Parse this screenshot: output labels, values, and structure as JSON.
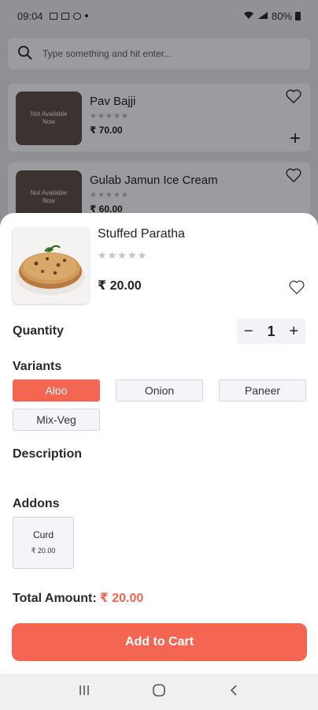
{
  "status_bar": {
    "time": "09:04",
    "battery": "80%"
  },
  "background_list": {
    "search_placeholder": "Type something and hit enter...",
    "items": [
      {
        "name": "Pav Bajji",
        "price": "₹ 70.00",
        "stars": "★★★★★",
        "badge": "Not Available Now"
      },
      {
        "name": "Gulab Jamun Ice Cream",
        "price": "₹ 60.00",
        "stars": "★★★★★",
        "badge": "Not Available Now"
      }
    ]
  },
  "product": {
    "name": "Stuffed Paratha",
    "stars": "★★★★★",
    "price": "₹ 20.00"
  },
  "quantity": {
    "label": "Quantity",
    "minus": "−",
    "value": "1",
    "plus": "+"
  },
  "variants": {
    "label": "Variants",
    "options": [
      "Aloo",
      "Onion",
      "Paneer",
      "Mix-Veg"
    ],
    "selected": "Aloo"
  },
  "description": {
    "label": "Description"
  },
  "addons": {
    "label": "Addons",
    "items": [
      {
        "name": "Curd",
        "price": "₹ 20.00"
      }
    ]
  },
  "total": {
    "label": "Total Amount:",
    "amount": "₹ 20.00"
  },
  "cart_button": "Add to Cart",
  "colors": {
    "accent": "#f46552",
    "overlay": "#8e9093",
    "sheet": "#ffffff"
  },
  "icons": [
    "search-icon",
    "heart-icon",
    "plus-icon",
    "recents-icon",
    "home-icon",
    "back-icon"
  ]
}
